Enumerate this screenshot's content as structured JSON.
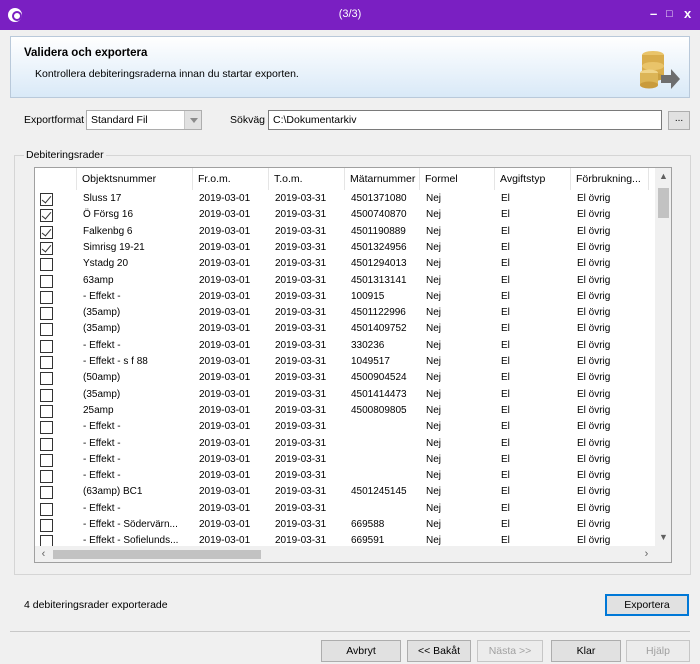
{
  "window": {
    "title": "(3/3)",
    "min": "–",
    "max": "□",
    "close": "x"
  },
  "header": {
    "title": "Validera och exportera",
    "subtitle": "Kontrollera debiteringsraderna innan du startar exporten."
  },
  "form": {
    "exportformat_label": "Exportformat",
    "exportformat_value": "Standard Fil",
    "path_label": "Sökväg",
    "path_value": "C:\\Dokumentarkiv",
    "browse_label": "..."
  },
  "group": {
    "title": "Debiteringsrader"
  },
  "grid": {
    "columns": [
      "Objektsnummer",
      "Fr.o.m.",
      "T.o.m.",
      "Mätarnummer",
      "Formel",
      "Avgiftstyp",
      "Förbrukning..."
    ],
    "rows": [
      {
        "checked": true,
        "obj": "Sluss 17",
        "from": "2019-03-01",
        "to": "2019-03-31",
        "meter": "4501371080",
        "formel": "Nej",
        "type": "El",
        "forb": "El övrig"
      },
      {
        "checked": true,
        "obj": "Ö Försg 16",
        "from": "2019-03-01",
        "to": "2019-03-31",
        "meter": "4500740870",
        "formel": "Nej",
        "type": "El",
        "forb": "El övrig"
      },
      {
        "checked": true,
        "obj": "Falkenbg 6",
        "from": "2019-03-01",
        "to": "2019-03-31",
        "meter": "4501190889",
        "formel": "Nej",
        "type": "El",
        "forb": "El övrig"
      },
      {
        "checked": true,
        "obj": "Simrisg 19-21",
        "from": "2019-03-01",
        "to": "2019-03-31",
        "meter": "4501324956",
        "formel": "Nej",
        "type": "El",
        "forb": "El övrig"
      },
      {
        "checked": false,
        "obj": "Ystadg 20",
        "from": "2019-03-01",
        "to": "2019-03-31",
        "meter": "4501294013",
        "formel": "Nej",
        "type": "El",
        "forb": "El övrig"
      },
      {
        "checked": false,
        "obj": "63amp",
        "from": "2019-03-01",
        "to": "2019-03-31",
        "meter": "4501313141",
        "formel": "Nej",
        "type": "El",
        "forb": "El övrig"
      },
      {
        "checked": false,
        "obj": " - Effekt -",
        "from": "2019-03-01",
        "to": "2019-03-31",
        "meter": "100915",
        "formel": "Nej",
        "type": "El",
        "forb": "El övrig"
      },
      {
        "checked": false,
        "obj": "(35amp)",
        "from": "2019-03-01",
        "to": "2019-03-31",
        "meter": "4501122996",
        "formel": "Nej",
        "type": "El",
        "forb": "El övrig"
      },
      {
        "checked": false,
        "obj": "(35amp)",
        "from": "2019-03-01",
        "to": "2019-03-31",
        "meter": "4501409752",
        "formel": "Nej",
        "type": "El",
        "forb": "El övrig"
      },
      {
        "checked": false,
        "obj": " - Effekt -",
        "from": "2019-03-01",
        "to": "2019-03-31",
        "meter": "330236",
        "formel": "Nej",
        "type": "El",
        "forb": "El övrig"
      },
      {
        "checked": false,
        "obj": " - Effekt - s f 88",
        "from": "2019-03-01",
        "to": "2019-03-31",
        "meter": "1049517",
        "formel": "Nej",
        "type": "El",
        "forb": "El övrig"
      },
      {
        "checked": false,
        "obj": "(50amp)",
        "from": "2019-03-01",
        "to": "2019-03-31",
        "meter": "4500904524",
        "formel": "Nej",
        "type": "El",
        "forb": "El övrig"
      },
      {
        "checked": false,
        "obj": "(35amp)",
        "from": "2019-03-01",
        "to": "2019-03-31",
        "meter": "4501414473",
        "formel": "Nej",
        "type": "El",
        "forb": "El övrig"
      },
      {
        "checked": false,
        "obj": "25amp",
        "from": "2019-03-01",
        "to": "2019-03-31",
        "meter": "4500809805",
        "formel": "Nej",
        "type": "El",
        "forb": "El övrig"
      },
      {
        "checked": false,
        "obj": " - Effekt -",
        "from": "2019-03-01",
        "to": "2019-03-31",
        "meter": "",
        "formel": "Nej",
        "type": "El",
        "forb": "El övrig"
      },
      {
        "checked": false,
        "obj": " - Effekt -",
        "from": "2019-03-01",
        "to": "2019-03-31",
        "meter": "",
        "formel": "Nej",
        "type": "El",
        "forb": "El övrig"
      },
      {
        "checked": false,
        "obj": " - Effekt -",
        "from": "2019-03-01",
        "to": "2019-03-31",
        "meter": "",
        "formel": "Nej",
        "type": "El",
        "forb": "El övrig"
      },
      {
        "checked": false,
        "obj": " - Effekt -",
        "from": "2019-03-01",
        "to": "2019-03-31",
        "meter": "",
        "formel": "Nej",
        "type": "El",
        "forb": "El övrig"
      },
      {
        "checked": false,
        "obj": "(63amp) BC1",
        "from": "2019-03-01",
        "to": "2019-03-31",
        "meter": "4501245145",
        "formel": "Nej",
        "type": "El",
        "forb": "El övrig"
      },
      {
        "checked": false,
        "obj": " - Effekt -",
        "from": "2019-03-01",
        "to": "2019-03-31",
        "meter": "",
        "formel": "Nej",
        "type": "El",
        "forb": "El övrig"
      },
      {
        "checked": false,
        "obj": " - Effekt - Södervärn...",
        "from": "2019-03-01",
        "to": "2019-03-31",
        "meter": "669588",
        "formel": "Nej",
        "type": "El",
        "forb": "El övrig"
      },
      {
        "checked": false,
        "obj": " - Effekt - Sofielunds...",
        "from": "2019-03-01",
        "to": "2019-03-31",
        "meter": "669591",
        "formel": "Nej",
        "type": "El",
        "forb": "El övrig"
      }
    ]
  },
  "status": {
    "text": "4 debiteringsrader exporterade"
  },
  "buttons": {
    "export": "Exportera",
    "cancel": "Avbryt",
    "back": "<< Bakåt",
    "next": "Nästa >>",
    "done": "Klar",
    "help": "Hjälp"
  },
  "colors": {
    "titlebar": "#7a1fc2",
    "header_gradient_end": "#d9e9f7",
    "accent": "#0078d7"
  }
}
